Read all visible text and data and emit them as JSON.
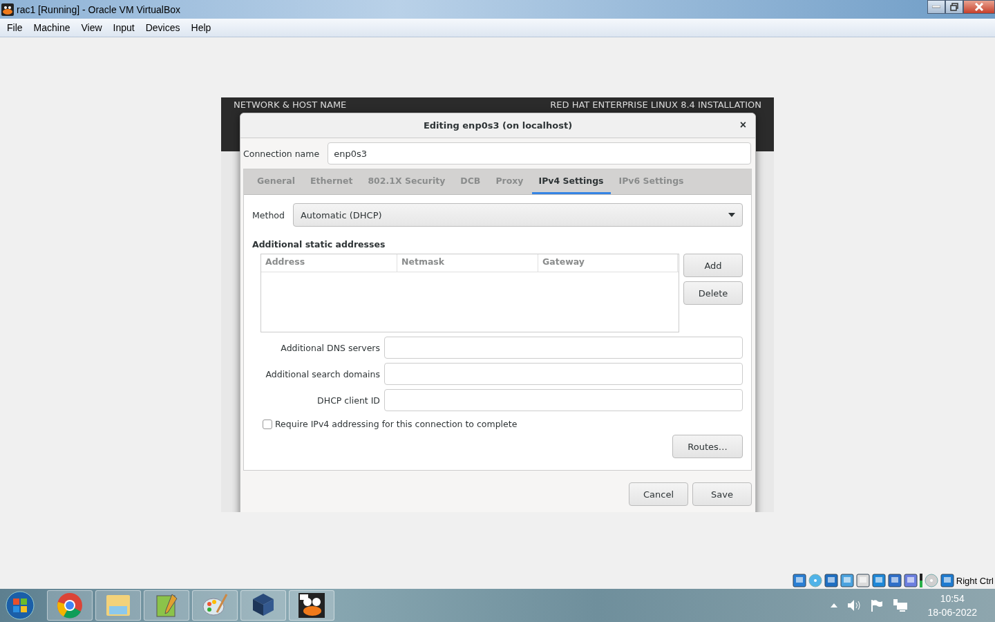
{
  "window": {
    "title": "rac1 [Running] - Oracle VM VirtualBox"
  },
  "menu": [
    "File",
    "Machine",
    "View",
    "Input",
    "Devices",
    "Help"
  ],
  "installer": {
    "section_title": "NETWORK & HOST NAME",
    "product_title": "RED HAT ENTERPRISE LINUX 8.4 INSTALLATION"
  },
  "dialog": {
    "title": "Editing enp0s3 (on localhost)",
    "close": "×",
    "connection_name_label": "Connection name",
    "connection_name": "enp0s3",
    "tabs": [
      {
        "label": "General",
        "selected": false
      },
      {
        "label": "Ethernet",
        "selected": false
      },
      {
        "label": "802.1X Security",
        "selected": false
      },
      {
        "label": "DCB",
        "selected": false
      },
      {
        "label": "Proxy",
        "selected": false
      },
      {
        "label": "IPv4 Settings",
        "selected": true
      },
      {
        "label": "IPv6 Settings",
        "selected": false
      }
    ],
    "method_label": "Method",
    "method": "Automatic (DHCP)",
    "addresses_title": "Additional static addresses",
    "address_columns": [
      "Address",
      "Netmask",
      "Gateway"
    ],
    "address_buttons": [
      "Add",
      "Delete"
    ],
    "fields": [
      {
        "label": "Additional DNS servers"
      },
      {
        "label": "Additional search domains"
      },
      {
        "label": "DHCP client ID"
      }
    ],
    "require_checkbox": {
      "label": "Require IPv4 addressing for this connection to complete",
      "checked": false
    },
    "routes_button": "Routes…",
    "buttons": [
      "Cancel",
      "Save"
    ]
  },
  "status_bar": {
    "host_key": "Right Ctrl"
  },
  "taskbar": {
    "time": "10:54",
    "date": "18-06-2022"
  }
}
